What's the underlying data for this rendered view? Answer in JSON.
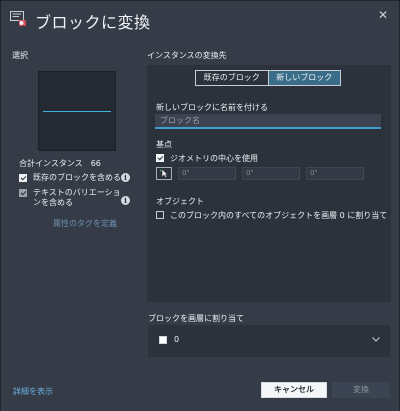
{
  "dialog": {
    "title": "ブロックに変換",
    "close_glyph": "✕"
  },
  "selection": {
    "title": "選択",
    "total_label": "合計インスタンス",
    "total_count": "66",
    "include_existing_label": "既存のブロックを含める",
    "include_text_variation_label": "テキストのバリエーションを含める",
    "define_attribute_tags_label": "属性のタグを定義",
    "info_glyph": "i"
  },
  "instance_target": {
    "title": "インスタンスの変換先",
    "tabs": [
      {
        "label": "既存のブロック",
        "active": false
      },
      {
        "label": "新しいブロック",
        "active": true
      }
    ],
    "name_label": "新しいブロックに名前を付ける",
    "name_placeholder": "ブロック名",
    "base_point_label": "基点",
    "geometry_center_label": "ジオメトリの中心を使用",
    "coords": [
      "0\"",
      "0\"",
      "0\""
    ],
    "object_label": "オブジェクト",
    "assign_layer0_label": "このブロック内のすべてのオブジェクトを画層 0 に割り当て"
  },
  "layer": {
    "label": "ブロックを画層に割り当て",
    "value": "0",
    "swatch_color": "#ffffff"
  },
  "footer": {
    "details_label": "詳細を表示",
    "cancel_label": "キャンセル",
    "convert_label": "変換"
  },
  "colors": {
    "accent": "#3fa0cc",
    "active_tab": "#3a6d8a",
    "link": "#6aaede"
  }
}
